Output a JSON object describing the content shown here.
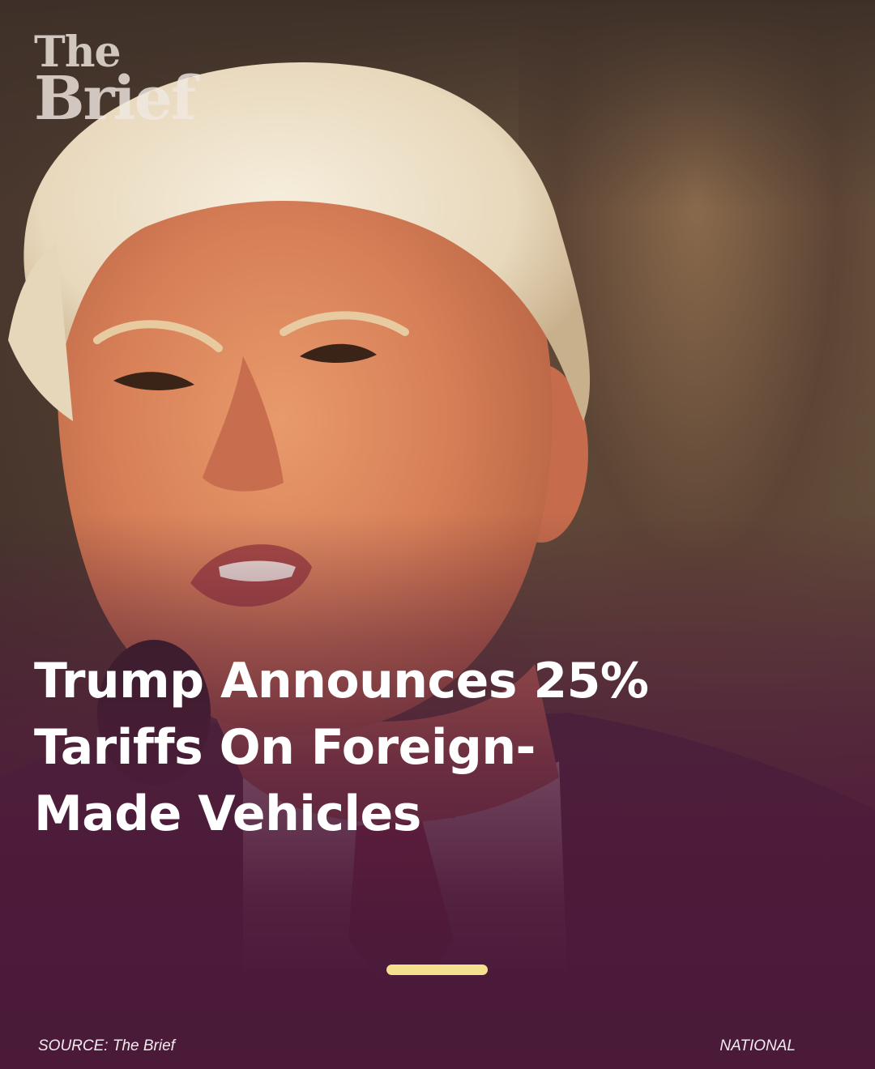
{
  "brand": {
    "logo_line1": "The",
    "logo_line2": "Brief"
  },
  "story": {
    "headline": "Trump Announces 25% Tariffs On Foreign-Made Vehicles"
  },
  "footer": {
    "source": "SOURCE: The Brief",
    "category": "NATIONAL"
  },
  "colors": {
    "overlay": "#4a1a38",
    "indicator": "#f5e08e",
    "text": "#ffffff"
  },
  "icons": {
    "slide_indicator": "pill-indicator"
  }
}
